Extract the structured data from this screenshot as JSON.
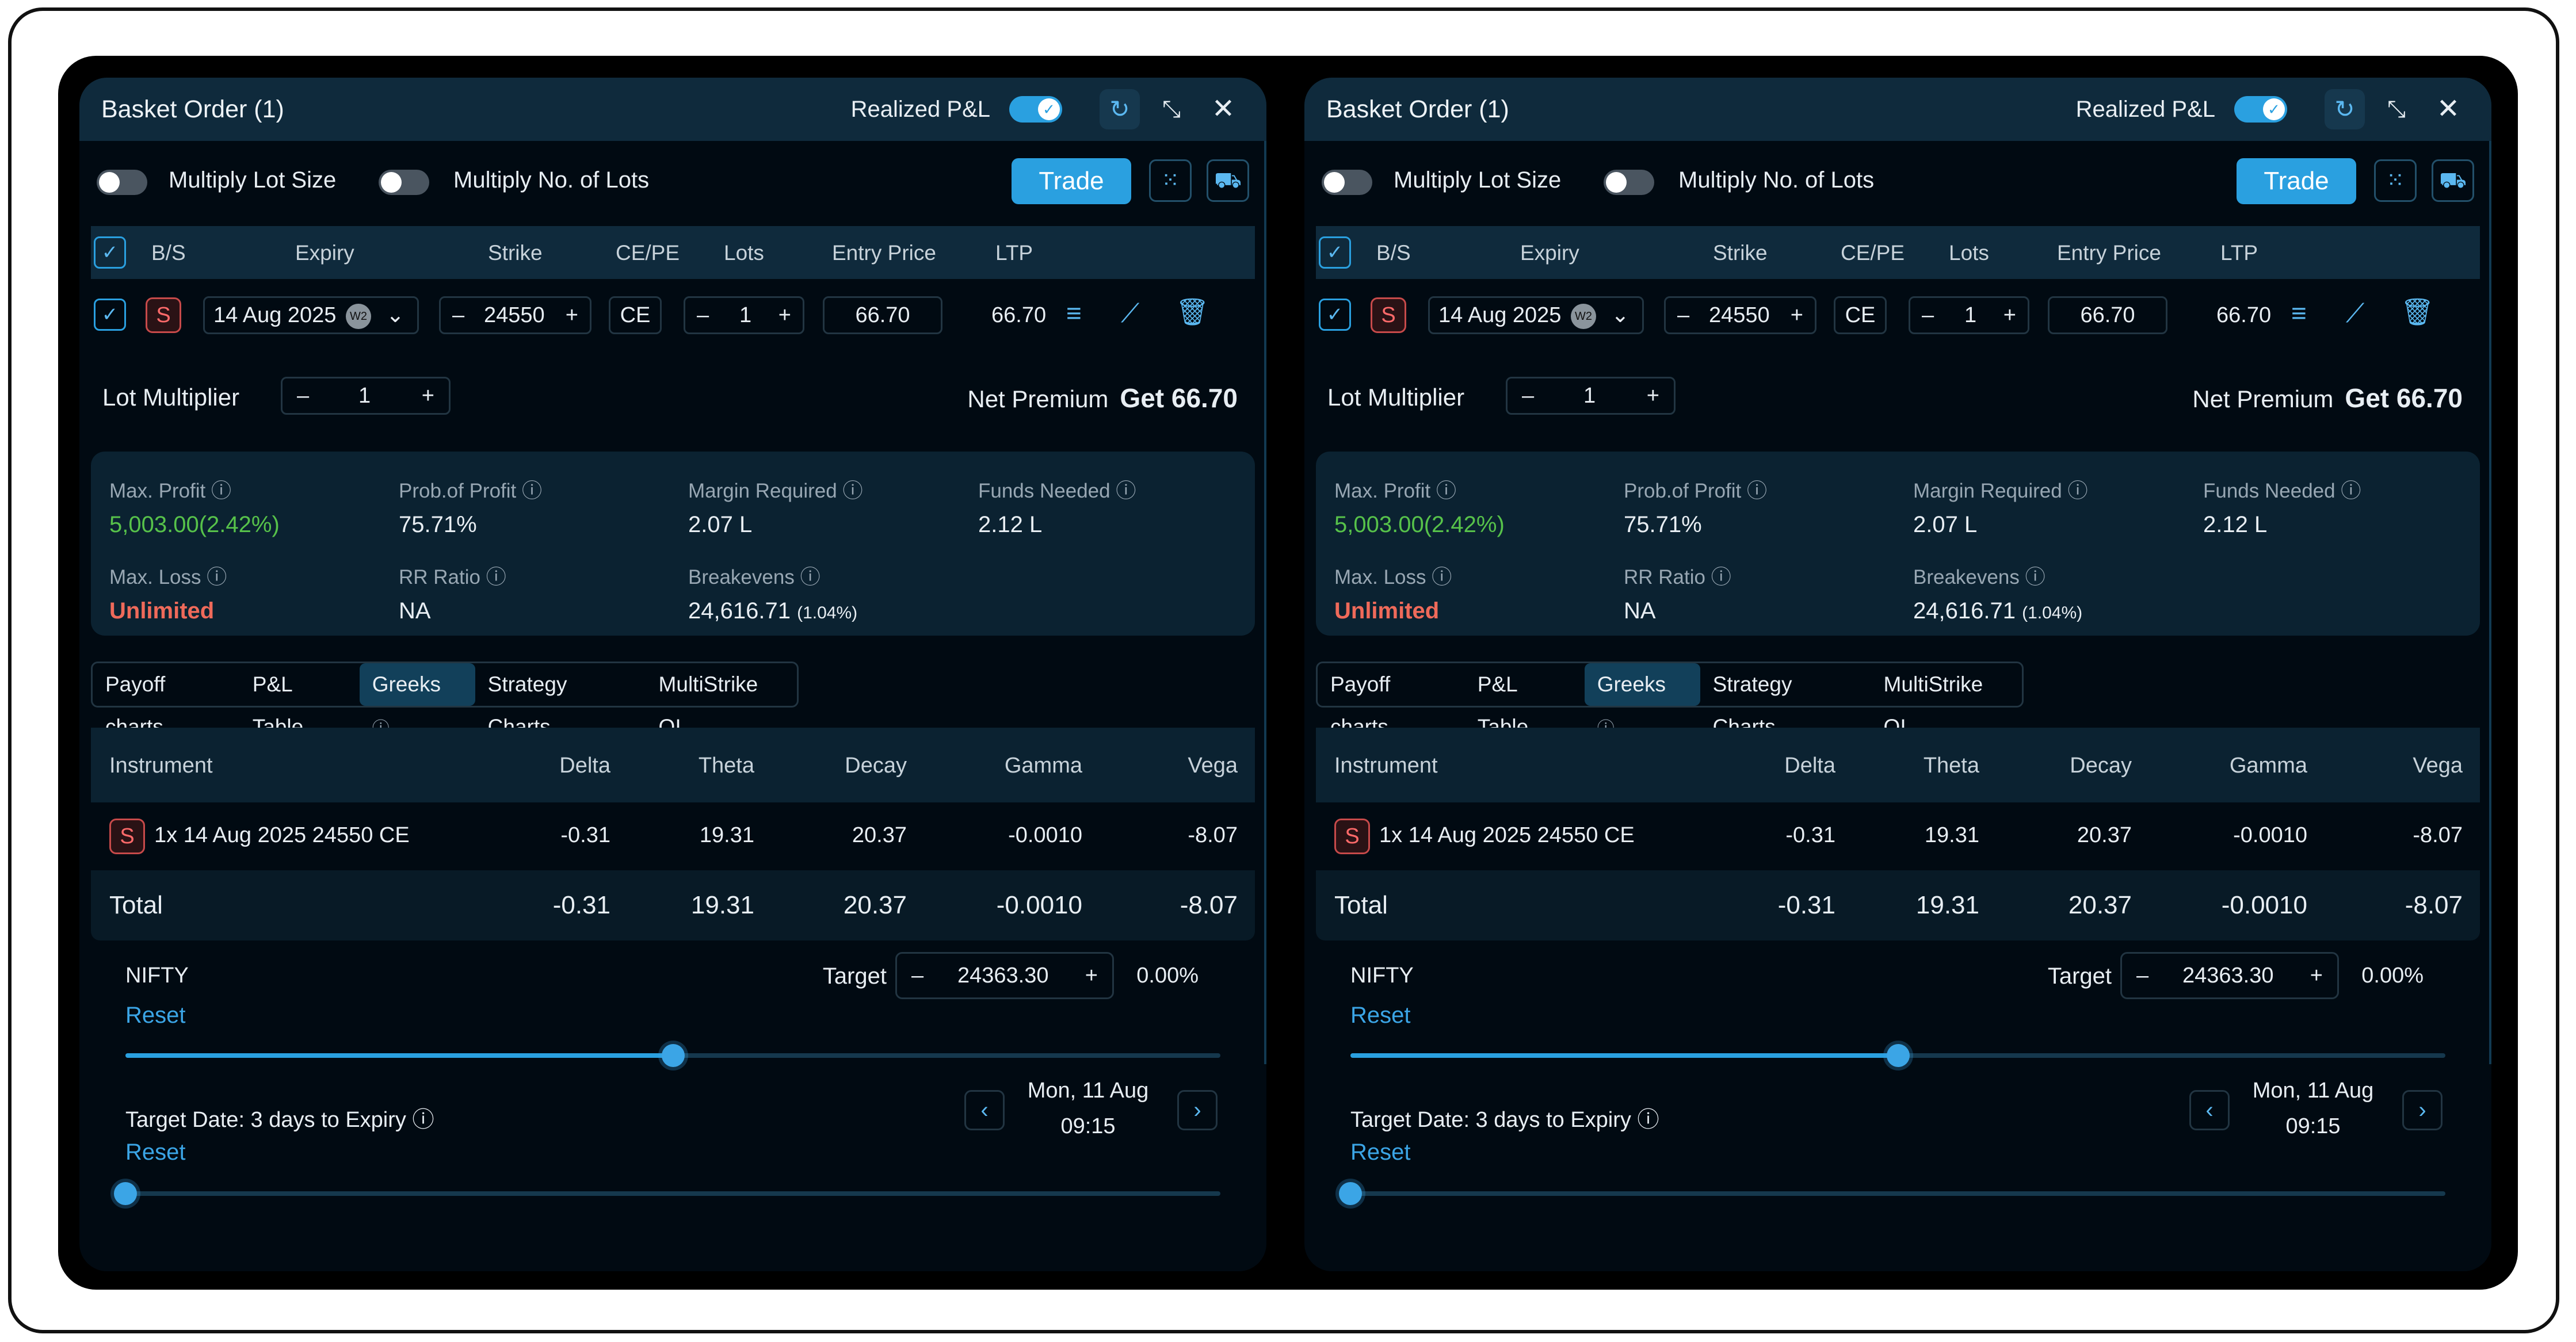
{
  "panels": [
    {
      "title": "Basket Order (1)",
      "realized_label": "Realized P&L",
      "realized_on": true,
      "multiply_lot_size_label": "Multiply Lot Size",
      "multiply_no_lots_label": "Multiply No. of Lots",
      "trade_label": "Trade",
      "table_headers": {
        "bs": "B/S",
        "expiry": "Expiry",
        "strike": "Strike",
        "cepe": "CE/PE",
        "lots": "Lots",
        "entry": "Entry Price",
        "ltp": "LTP"
      },
      "leg": {
        "side": "S",
        "expiry": "14 Aug 2025",
        "week_badge": "W2",
        "strike": "24550",
        "type": "CE",
        "lots": "1",
        "entry": "66.70",
        "ltp": "66.70"
      },
      "lot_multiplier_label": "Lot Multiplier",
      "lot_multiplier_value": "1",
      "net_premium_label": "Net Premium",
      "net_premium_value": "Get 66.70",
      "stats": {
        "max_profit_label": "Max. Profit",
        "max_profit_value": "5,003.00(2.42%)",
        "prob_profit_label": "Prob.of Profit",
        "prob_profit_value": "75.71%",
        "margin_label": "Margin Required",
        "margin_value": "2.07 L",
        "funds_label": "Funds Needed",
        "funds_value": "2.12 L",
        "max_loss_label": "Max. Loss",
        "max_loss_value": "Unlimited",
        "rr_label": "RR Ratio",
        "rr_value": "NA",
        "breakeven_label": "Breakevens",
        "breakeven_value": "24,616.71",
        "breakeven_pct": "(1.04%)"
      },
      "tabs": [
        "Payoff charts",
        "P&L Table",
        "Greeks",
        "Strategy Charts",
        "MultiStrike OI"
      ],
      "active_tab": "Greeks",
      "greeks_headers": {
        "instrument": "Instrument",
        "delta": "Delta",
        "theta": "Theta",
        "decay": "Decay",
        "gamma": "Gamma",
        "vega": "Vega"
      },
      "greeks_row": {
        "side": "S",
        "instrument": "1x 14 Aug 2025 24550 CE",
        "delta": "-0.31",
        "theta": "19.31",
        "decay": "20.37",
        "gamma": "-0.0010",
        "vega": "-8.07"
      },
      "greeks_total": {
        "label": "Total",
        "delta": "-0.31",
        "theta": "19.31",
        "decay": "20.37",
        "gamma": "-0.0010",
        "vega": "-8.07"
      },
      "nifty_label": "NIFTY",
      "reset_label": "Reset",
      "target_label": "Target",
      "target_value": "24363.30",
      "target_pct": "0.00%",
      "target_slider_level": 0.5,
      "target_date_label": "Target Date: 3 days to Expiry",
      "target_date_day": "Mon, 11 Aug",
      "target_date_time": "09:15",
      "date_slider_level": 0.0
    },
    {
      "title": "Basket Order (1)",
      "realized_label": "Realized P&L",
      "realized_on": true,
      "multiply_lot_size_label": "Multiply Lot Size",
      "multiply_no_lots_label": "Multiply No. of Lots",
      "trade_label": "Trade",
      "table_headers": {
        "bs": "B/S",
        "expiry": "Expiry",
        "strike": "Strike",
        "cepe": "CE/PE",
        "lots": "Lots",
        "entry": "Entry Price",
        "ltp": "LTP"
      },
      "leg": {
        "side": "S",
        "expiry": "14 Aug 2025",
        "week_badge": "W2",
        "strike": "24550",
        "type": "CE",
        "lots": "1",
        "entry": "66.70",
        "ltp": "66.70"
      },
      "lot_multiplier_label": "Lot Multiplier",
      "lot_multiplier_value": "1",
      "net_premium_label": "Net Premium",
      "net_premium_value": "Get 66.70",
      "stats": {
        "max_profit_label": "Max. Profit",
        "max_profit_value": "5,003.00(2.42%)",
        "prob_profit_label": "Prob.of Profit",
        "prob_profit_value": "75.71%",
        "margin_label": "Margin Required",
        "margin_value": "2.07 L",
        "funds_label": "Funds Needed",
        "funds_value": "2.12 L",
        "max_loss_label": "Max. Loss",
        "max_loss_value": "Unlimited",
        "rr_label": "RR Ratio",
        "rr_value": "NA",
        "breakeven_label": "Breakevens",
        "breakeven_value": "24,616.71",
        "breakeven_pct": "(1.04%)"
      },
      "tabs": [
        "Payoff charts",
        "P&L Table",
        "Greeks",
        "Strategy Charts",
        "MultiStrike OI"
      ],
      "active_tab": "Greeks",
      "greeks_headers": {
        "instrument": "Instrument",
        "delta": "Delta",
        "theta": "Theta",
        "decay": "Decay",
        "gamma": "Gamma",
        "vega": "Vega"
      },
      "greeks_row": {
        "side": "S",
        "instrument": "1x 14 Aug 2025 24550 CE",
        "delta": "-0.31",
        "theta": "19.31",
        "decay": "20.37",
        "gamma": "-0.0010",
        "vega": "-8.07"
      },
      "greeks_total": {
        "label": "Total",
        "delta": "-0.31",
        "theta": "19.31",
        "decay": "20.37",
        "gamma": "-0.0010",
        "vega": "-8.07"
      },
      "nifty_label": "NIFTY",
      "reset_label": "Reset",
      "target_label": "Target",
      "target_value": "24363.30",
      "target_pct": "0.00%",
      "target_slider_level": 0.5,
      "target_date_label": "Target Date: 3 days to Expiry",
      "target_date_day": "Mon, 11 Aug",
      "target_date_time": "09:15",
      "date_slider_level": 0.0
    }
  ],
  "icons": {
    "refresh": "refresh-icon",
    "minimize": "minimize-icon",
    "close": "close-icon",
    "grid": "grid-icon",
    "basket": "basket-icon",
    "filter": "filter-icon",
    "chart": "chart-icon",
    "delete": "trash-icon",
    "info": "info-icon"
  },
  "colors": {
    "accent": "#2aa0e0",
    "profit": "#57c24a",
    "loss": "#ef6a5a",
    "panel": "#010a12",
    "header": "#0f2a3c"
  }
}
